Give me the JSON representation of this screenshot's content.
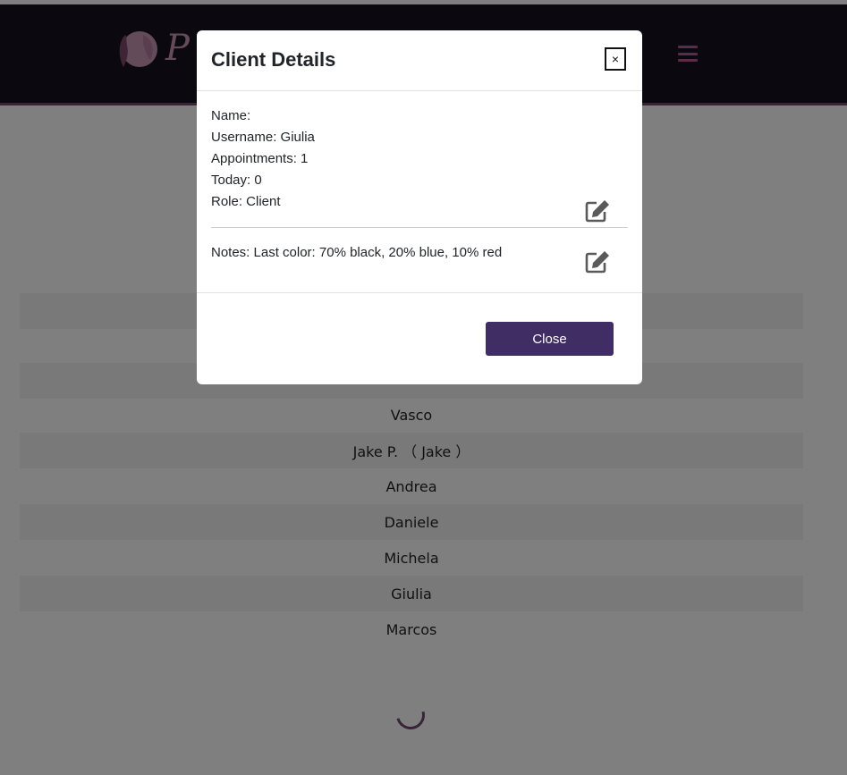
{
  "header": {
    "logo_text": "P"
  },
  "clients": [
    "Vasco",
    "Jake P.  （ Jake ）",
    "Andrea",
    "Daniele",
    "Michela",
    "Giulia",
    "Marcos"
  ],
  "modal": {
    "title": "Client Details",
    "close_x": "×",
    "name_line": "Name:",
    "username_line": "Username: Giulia",
    "appointments_line": "Appointments: 1",
    "today_line": "Today: 0",
    "role_line": "Role: Client",
    "notes_line": "Notes: Last color: 70% black, 20% blue, 10% red",
    "close_button": "Close"
  },
  "icons": {
    "edit": "edit-icon",
    "menu": "hamburger-menu-icon",
    "loading": "loading-spinner-icon"
  },
  "colors": {
    "header_bg": "#17131e",
    "accent_purple": "#3f2d63",
    "spinner": "#6f4a6e"
  }
}
